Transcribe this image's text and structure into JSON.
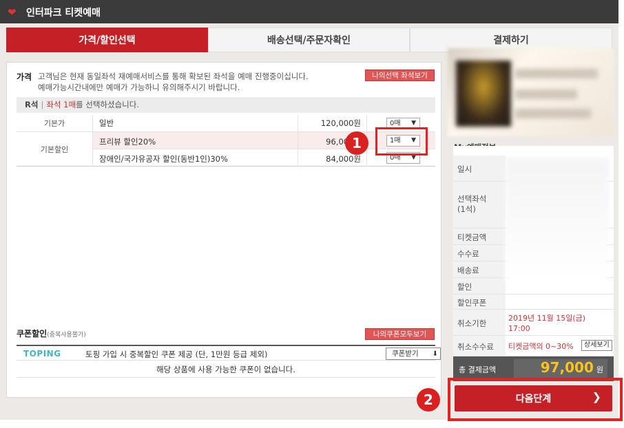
{
  "window": {
    "title": "인터파크 티켓예매"
  },
  "steps": [
    "가격/할인선택",
    "배송선택/주문자확인",
    "결제하기"
  ],
  "price_section": {
    "label": "가격",
    "desc_line1": "고객님은 현재 동일좌석 재예매서비스를 통해 확보된 좌석을 예매 진행중이십니다.",
    "desc_line2": "예매가능시간내에만 예매가 가능하니 유의해주시기 바랍니다.",
    "seat_button": "나의선택 좌석보기",
    "seat_grade": "R석",
    "seat_sep": "|",
    "seat_count": "좌석 1매",
    "seat_suffix": "를 선택하셨습니다."
  },
  "price_rows": [
    {
      "category": "기본가",
      "name": "일반",
      "amount": "120,000원",
      "qty": "0매"
    },
    {
      "category": "기본할인",
      "name": "프리뷰 할인20%",
      "amount": "96,000원",
      "qty": "1매"
    },
    {
      "category": "",
      "name": "장애인/국가유공자 할인(동반1인)30%",
      "amount": "84,000원",
      "qty": "0매"
    }
  ],
  "coupon_section": {
    "label": "쿠폰할인",
    "sublabel": "(중복사용불가)",
    "button": "나의쿠폰모두보기",
    "brand": "TOPING",
    "promo": "토핑 가입 시 중복할인 쿠폰 제공 (단, 1만원 등급 제외)",
    "coupon_button": "쿠폰받기",
    "empty": "해당 상품에 사용 가능한 쿠폰이 없습니다."
  },
  "my_booking": {
    "header": "My예매정보",
    "rows": [
      {
        "key": "일시",
        "value": ""
      },
      {
        "key": "선택좌석\n(1석)",
        "value": ""
      },
      {
        "key": "티켓금액",
        "value": ""
      },
      {
        "key": "수수료",
        "value": ""
      },
      {
        "key": "배송료",
        "value": ""
      },
      {
        "key": "할인",
        "value": ""
      },
      {
        "key": "할인쿠폰",
        "value": ""
      }
    ],
    "cancel_deadline_key": "취소기한",
    "cancel_deadline_value": "2019년 11월 15일(금)\n17:00",
    "cancel_fee_key": "취소수수료",
    "cancel_fee_value": "티켓금액의 0~30%",
    "cancel_fee_button": "상세보기",
    "total_key": "총 결제금액",
    "total_value": "97,000",
    "total_unit": "원"
  },
  "next_button": "다음단계",
  "annotations": {
    "badge1": "1",
    "badge2": "2",
    "highlight_color": "#e52222"
  },
  "colors": {
    "brand_red": "#c42026",
    "price_gold": "#ffc21a",
    "titlebar": "#3b3b3b"
  },
  "icons": {
    "logo": "heart-icon",
    "select_arrow": "triangle-down-icon",
    "download": "download-icon",
    "next": "chevron-right-icon"
  }
}
